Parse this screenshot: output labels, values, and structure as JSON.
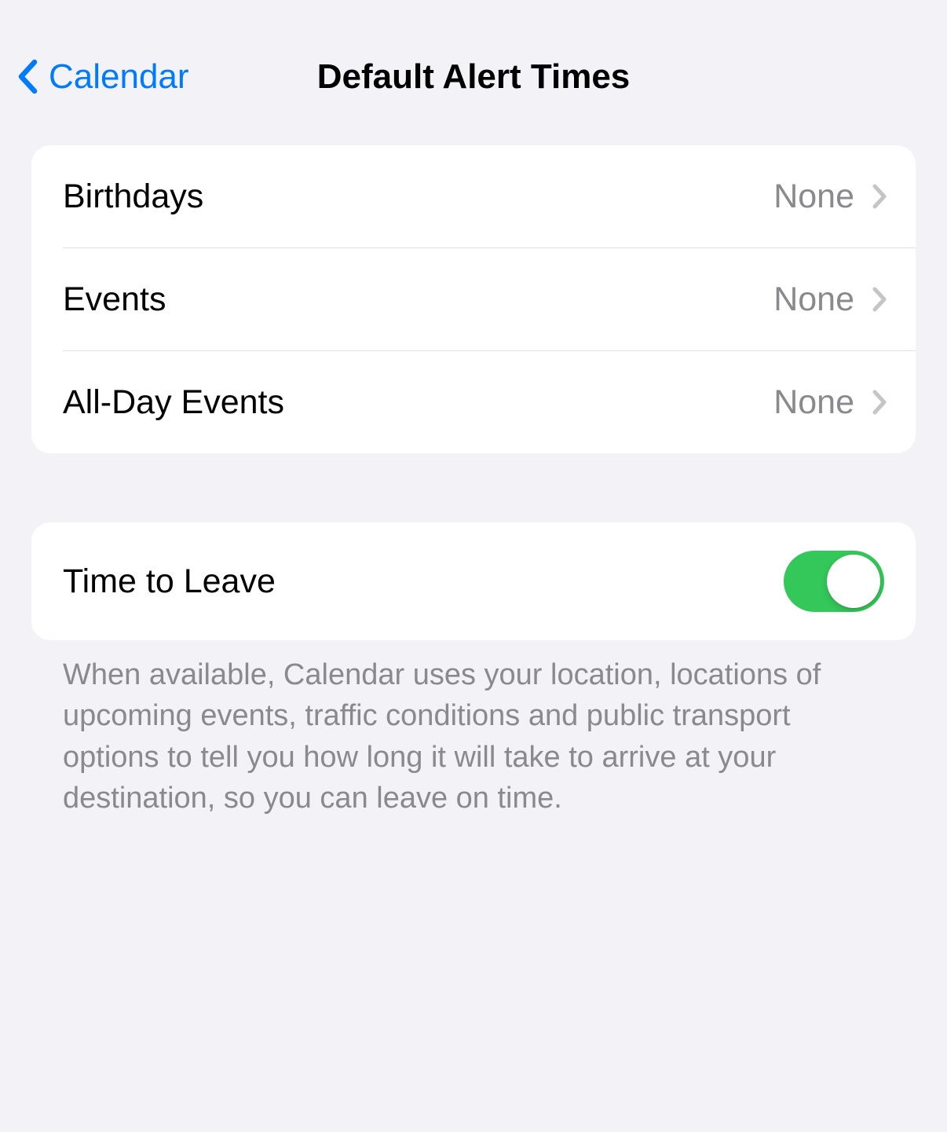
{
  "nav": {
    "back_label": "Calendar",
    "title": "Default Alert Times"
  },
  "alertGroup": {
    "rows": [
      {
        "label": "Birthdays",
        "value": "None"
      },
      {
        "label": "Events",
        "value": "None"
      },
      {
        "label": "All-Day Events",
        "value": "None"
      }
    ]
  },
  "timeToLeave": {
    "label": "Time to Leave",
    "enabled": true,
    "footer": "When available, Calendar uses your location, locations of upcoming events, traffic conditions and public transport options to tell you how long it will take to arrive at your destination, so you can leave on time."
  }
}
